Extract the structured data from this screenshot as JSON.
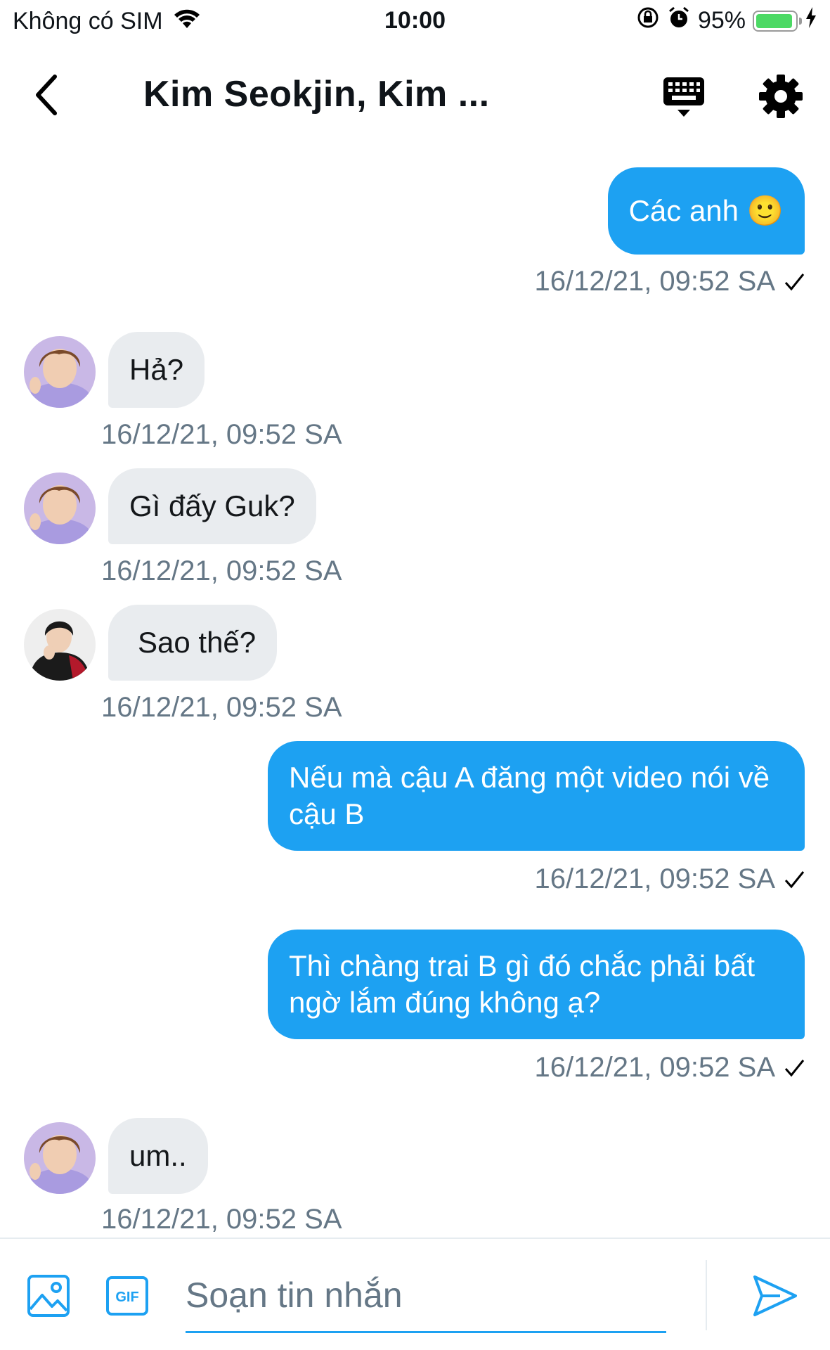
{
  "status_bar": {
    "carrier": "Không có SIM",
    "time": "10:00",
    "battery_percent": "95%",
    "battery_level": 0.95
  },
  "header": {
    "title": "Kim Seokjin, Kim ..."
  },
  "messages": [
    {
      "direction": "out",
      "text": "Các anh 🙂",
      "timestamp": "16/12/21, 09:52 SA"
    },
    {
      "direction": "in",
      "avatar": "avatar-1",
      "text": "Hả?",
      "timestamp": "16/12/21, 09:52 SA"
    },
    {
      "direction": "in",
      "avatar": "avatar-1",
      "text": "Gì đấy Guk?",
      "timestamp": "16/12/21, 09:52 SA"
    },
    {
      "direction": "in",
      "avatar": "avatar-2",
      "text": "Sao thế?",
      "timestamp": "16/12/21, 09:52 SA"
    },
    {
      "direction": "out",
      "text": "Nếu mà cậu A đăng một video nói về cậu B",
      "timestamp": "16/12/21, 09:52 SA"
    },
    {
      "direction": "out",
      "text": "Thì chàng trai B gì đó chắc phải bất ngờ lắm đúng không ạ?",
      "timestamp": "16/12/21, 09:52 SA"
    },
    {
      "direction": "in",
      "avatar": "avatar-1",
      "text": "um..",
      "timestamp": "16/12/21, 09:52 SA"
    }
  ],
  "composer": {
    "placeholder": "Soạn tin nhắn",
    "gif_label": "GIF"
  },
  "colors": {
    "accent": "#1da1f2",
    "incoming_bubble": "#e9ecef",
    "timestamp": "#657786",
    "battery": "#4cd964"
  }
}
